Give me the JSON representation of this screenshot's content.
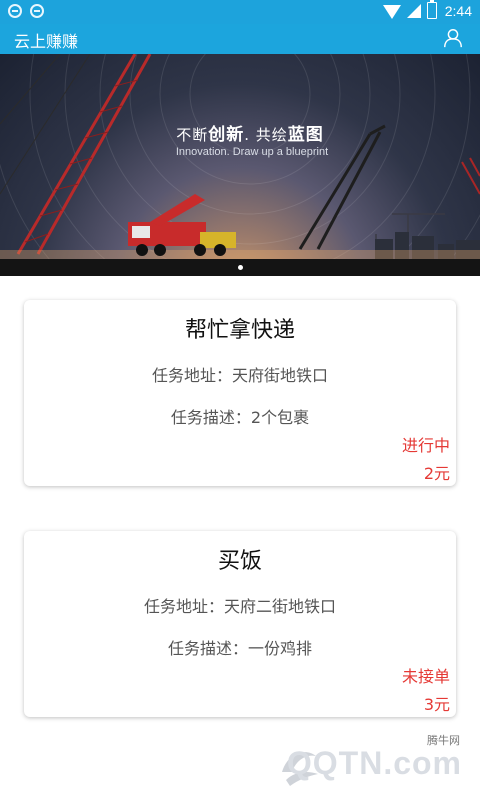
{
  "status_bar": {
    "time": "2:44"
  },
  "app_bar": {
    "title": "云上赚赚"
  },
  "banner": {
    "slogan_prefix": "不断",
    "slogan_bold1": "创新",
    "slogan_mid": ". 共绘",
    "slogan_bold2": "蓝图",
    "slogan_en": "Innovation. Draw up a blueprint"
  },
  "tasks": [
    {
      "title": "帮忙拿快递",
      "address": "任务地址：天府街地铁口",
      "description": "任务描述：2个包裹",
      "status": "进行中",
      "price": "2元"
    },
    {
      "title": "买饭",
      "address": "任务地址：天府二街地铁口",
      "description": "任务描述：一份鸡排",
      "status": "未接单",
      "price": "3元"
    }
  ],
  "watermark": {
    "text": "QQTN.com",
    "sub": "腾牛网"
  },
  "colors": {
    "primary": "#1ca5dd",
    "status_red": "#e53935"
  }
}
